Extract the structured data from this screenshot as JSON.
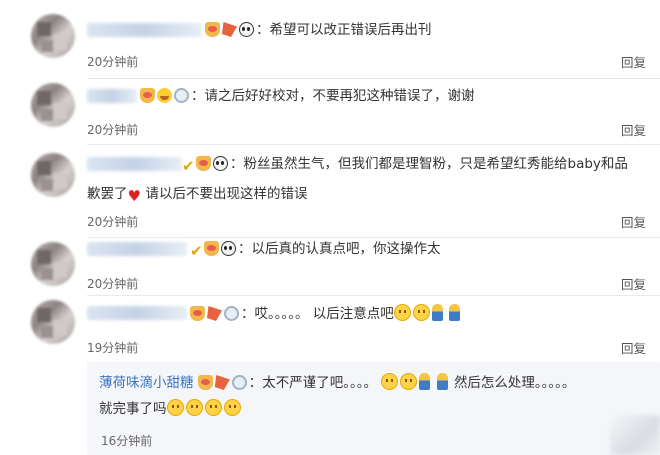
{
  "comments": [
    {
      "text": "希望可以改正错误后再出刊",
      "time": "20分钟前",
      "reply_label": "回复",
      "badges": [
        "crown-badge",
        "flag-badge",
        "panda-badge"
      ]
    },
    {
      "text": "请之后好好校对，不要再犯这种错误了，谢谢",
      "time": "20分钟前",
      "reply_label": "回复",
      "badges": [
        "crown-badge",
        "grin-emoji",
        "medal-badge"
      ]
    },
    {
      "text_line1": "粉丝虽然生气，但我们都是理智粉，只是希望红秀能给baby和品",
      "text_line2_a": "歉罢了",
      "text_line2_b": "请以后不要出现这样的错误",
      "time": "20分钟前",
      "reply_label": "回复",
      "badges": [
        "check-badge",
        "crown-badge",
        "panda-badge",
        "heart-emoji"
      ]
    },
    {
      "text": "以后真的认真点吧，你这操作太",
      "time": "20分钟前",
      "reply_label": "回复",
      "badges": [
        "check-badge",
        "crown-badge",
        "panda-badge"
      ]
    },
    {
      "text_a": "哎。。。。。",
      "text_b": "以后注意点吧",
      "time": "19分钟前",
      "reply_label": "回复",
      "badges": [
        "crown-badge",
        "flag-badge",
        "medal-badge"
      ]
    }
  ],
  "sub_reply": {
    "name": "薄荷味滴小甜糖",
    "text_a": "：太不严谨了吧。。。。",
    "text_b": "然后怎么处理。。。。。",
    "text_c": "就完事了吗",
    "time": "16分钟前"
  },
  "icons": {
    "check": "✔",
    "heart": "♥"
  },
  "colors": {
    "link_blue": "#3b74c1",
    "sub_bg": "#f4f6f9",
    "divider": "#e9e9e9"
  }
}
